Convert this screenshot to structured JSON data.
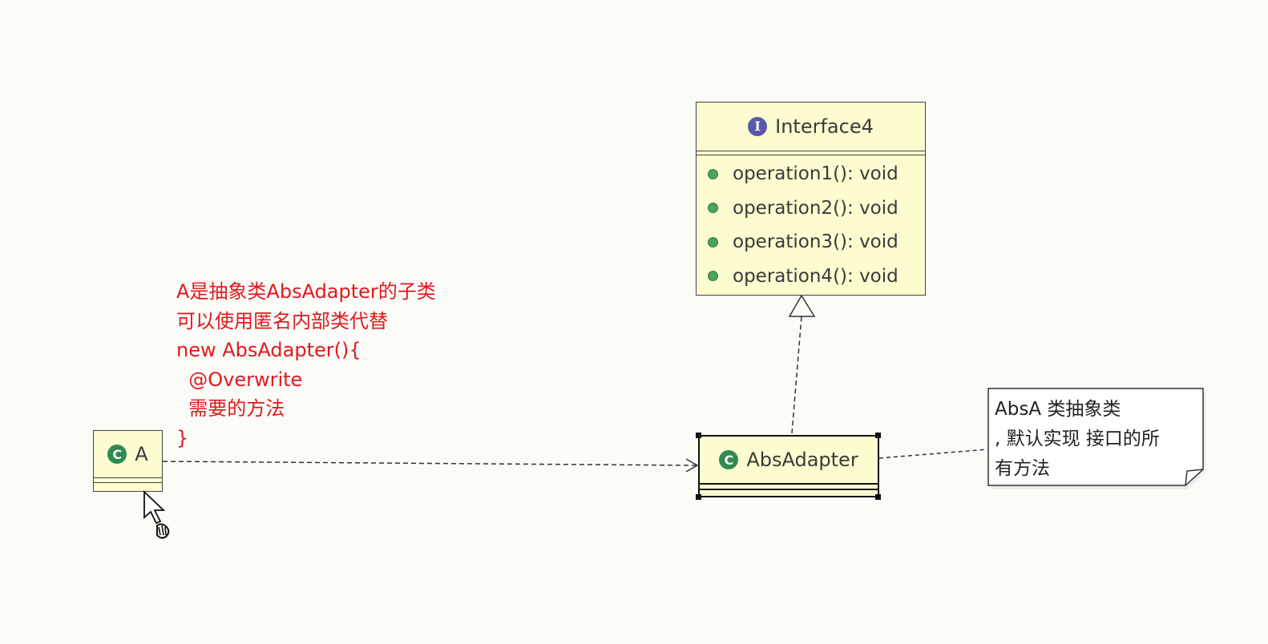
{
  "interface": {
    "name": "Interface4",
    "badge": "I",
    "operations": [
      "operation1(): void",
      "operation2(): void",
      "operation3(): void",
      "operation4(): void"
    ]
  },
  "abs_adapter": {
    "name": "AbsAdapter",
    "badge": "C"
  },
  "class_a": {
    "name": "A",
    "badge": "C"
  },
  "note": {
    "lines": [
      "AbsA 类抽象类",
      ", 默认实现 接口的所",
      "有方法"
    ]
  },
  "comment": {
    "lines": [
      "A是抽象类AbsAdapter的子类",
      "可以使用匿名内部类代替",
      "new AbsAdapter(){",
      "  @Overwrite",
      "  需要的方法",
      "}"
    ]
  },
  "colors": {
    "class_fill": "#fdfcd0",
    "comment_text": "#e0191d",
    "interface_badge": "#5a59a8",
    "class_badge": "#2f8a4f",
    "operation_dot": "#4ca260"
  },
  "icons": {
    "interface_badge": "interface-badge-icon",
    "class_badge": "class-badge-icon",
    "cursor": "hand-cursor-icon"
  }
}
